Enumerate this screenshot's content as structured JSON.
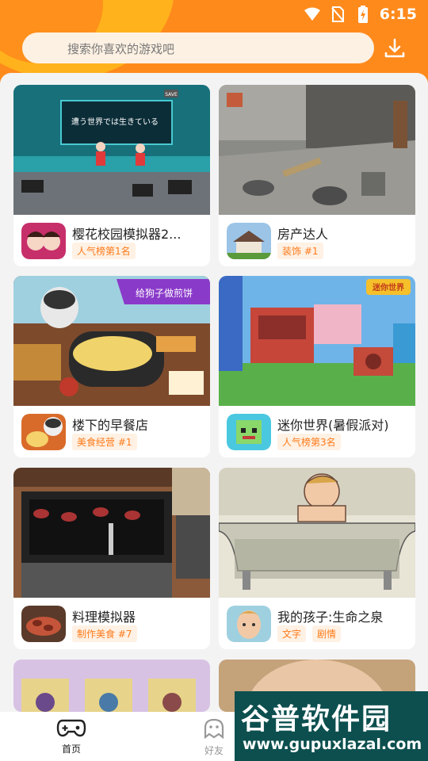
{
  "status_bar": {
    "time": "6:15",
    "icons": [
      "wifi-icon",
      "no-sim-icon",
      "battery-charging-icon"
    ]
  },
  "search": {
    "placeholder": "搜索你喜欢的游戏吧"
  },
  "header": {
    "download_icon": "download-icon"
  },
  "games": [
    {
      "title": "樱花校园模拟器2...",
      "tags": [
        "人气榜第1名"
      ]
    },
    {
      "title": "房产达人",
      "tags": [
        "装饰 #1"
      ]
    },
    {
      "title": "楼下的早餐店",
      "tags": [
        "美食经营 #1"
      ]
    },
    {
      "title": "迷你世界(暑假派对)",
      "tags": [
        "人气榜第3名"
      ]
    },
    {
      "title": "料理模拟器",
      "tags": [
        "制作美食 #7"
      ]
    },
    {
      "title": "我的孩子:生命之泉",
      "tags": [
        "文字",
        "剧情"
      ]
    }
  ],
  "screenshot_text": {
    "sakura_sign": "遭う世界では生きている",
    "dog_banner": "给狗子做煎饼",
    "mini_logo": "迷你世界",
    "sakura_save": "SAVE"
  },
  "bottom_nav": [
    {
      "label": "首页",
      "active": true,
      "icon": "gamepad-icon"
    },
    {
      "label": "好友",
      "active": false,
      "icon": "ghost-friends-icon"
    }
  ],
  "watermark": {
    "line1": "谷普软件园",
    "line2": "www.gupuxlazal.com"
  },
  "colors": {
    "accent": "#ff8a1c",
    "tag_text": "#ff7a1a",
    "tag_bg": "#fff1e4"
  }
}
